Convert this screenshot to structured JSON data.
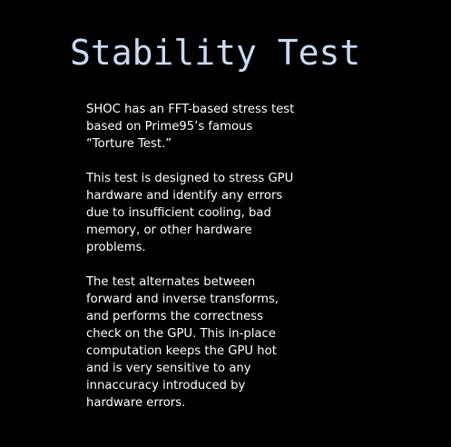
{
  "slide": {
    "title": "Stability Test",
    "paragraphs": [
      {
        "lines": [
          "SHOC has an FFT-based stress test",
          "based on Prime95’s famous",
          "“Torture Test.”"
        ]
      },
      {
        "lines": [
          "This test is designed to stress GPU",
          "hardware and identify any errors",
          "due to insufficient cooling, bad",
          "memory, or other hardware",
          "problems."
        ]
      },
      {
        "lines": [
          "The test alternates between",
          "forward and inverse transforms,",
          "and performs the correctness",
          "check on the GPU.  This in-place",
          "computation keeps the GPU hot",
          "and is very sensitive to any",
          "innaccuracy introduced by",
          "hardware errors."
        ]
      }
    ]
  },
  "colors": {
    "background": "#000000",
    "title": "#c8dbf5",
    "body": "#ffffff"
  }
}
